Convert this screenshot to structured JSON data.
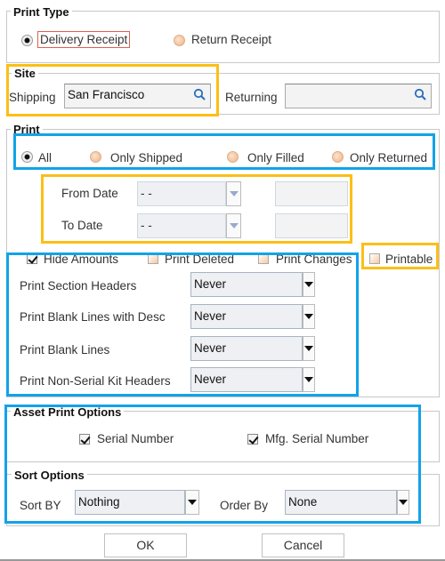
{
  "print_type": {
    "title": "Print Type",
    "options": [
      {
        "label": "Delivery Receipt",
        "selected": true
      },
      {
        "label": "Return Receipt",
        "selected": false
      }
    ]
  },
  "site": {
    "title": "Site",
    "shipping_label": "Shipping",
    "shipping_value": "San Francisco",
    "returning_label": "Returning",
    "returning_value": ""
  },
  "print": {
    "title": "Print",
    "options": [
      {
        "label": "All",
        "selected": true
      },
      {
        "label": "Only Shipped",
        "selected": false
      },
      {
        "label": "Only Filled",
        "selected": false
      },
      {
        "label": "Only Returned",
        "selected": false
      }
    ],
    "from_date_label": "From Date",
    "from_date_value": "- -",
    "to_date_label": "To Date",
    "to_date_value": "- -"
  },
  "checks": [
    {
      "label": "Hide Amounts",
      "checked": true
    },
    {
      "label": "Print Deleted",
      "checked": false
    },
    {
      "label": "Print Changes",
      "checked": false
    },
    {
      "label": "Printable",
      "checked": false
    }
  ],
  "rows": [
    {
      "label": "Print Section Headers",
      "value": "Never"
    },
    {
      "label": "Print Blank Lines with Desc",
      "value": "Never"
    },
    {
      "label": "Print Blank Lines",
      "value": "Never"
    },
    {
      "label": "Print Non-Serial Kit Headers",
      "value": "Never"
    }
  ],
  "asset": {
    "title": "Asset Print Options",
    "options": [
      {
        "label": "Serial Number",
        "checked": true
      },
      {
        "label": "Mfg. Serial Number",
        "checked": true
      }
    ]
  },
  "sort": {
    "title": "Sort Options",
    "sort_by_label": "Sort BY",
    "sort_by_value": "Nothing",
    "order_by_label": "Order By",
    "order_by_value": "None"
  },
  "buttons": {
    "ok": "OK",
    "cancel": "Cancel"
  },
  "colors": {
    "highlight_yellow": "#fbbf16",
    "highlight_blue": "#12a3e8",
    "focus_red": "#e06050"
  }
}
